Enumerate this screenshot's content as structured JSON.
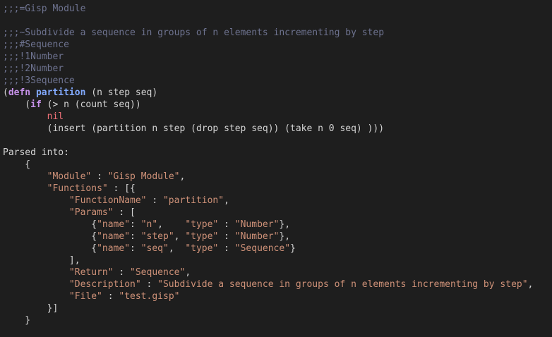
{
  "comments": {
    "module": ";;;=Gisp Module",
    "desc": ";;;~Subdivide a sequence in groups of n elements incrementing by step",
    "ret": ";;;#Sequence",
    "p1": ";;;!1Number",
    "p2": ";;;!2Number",
    "p3": ";;;!3Sequence"
  },
  "code": {
    "defn_kw": "defn",
    "fn_name": "partition",
    "params": " (n step seq)",
    "if_kw": "if",
    "cond": " (> n (count seq))",
    "nil": "nil",
    "else_expr": "(insert (partition n step (drop step seq)) (take n 0 seq) )))"
  },
  "parsed": {
    "label": "Parsed into:",
    "module_key": "\"Module\"",
    "module_val": "\"Gisp Module\"",
    "functions_key": "\"Functions\"",
    "fname_key": "\"FunctionName\"",
    "fname_val": "\"partition\"",
    "params_key": "\"Params\"",
    "name_key": "\"name\"",
    "type_key": "\"type\"",
    "p1_name": "\"n\"",
    "p1_type": "\"Number\"",
    "p2_name": "\"step\"",
    "p2_type": "\"Number\"",
    "p3_name": "\"seq\"",
    "p3_type": "\"Sequence\"",
    "return_key": "\"Return\"",
    "return_val": "\"Sequence\"",
    "desc_key": "\"Description\"",
    "desc_val": "\"Subdivide a sequence in groups of n elements incrementing by step\"",
    "file_key": "\"File\"",
    "file_val": "\"test.gisp\""
  }
}
